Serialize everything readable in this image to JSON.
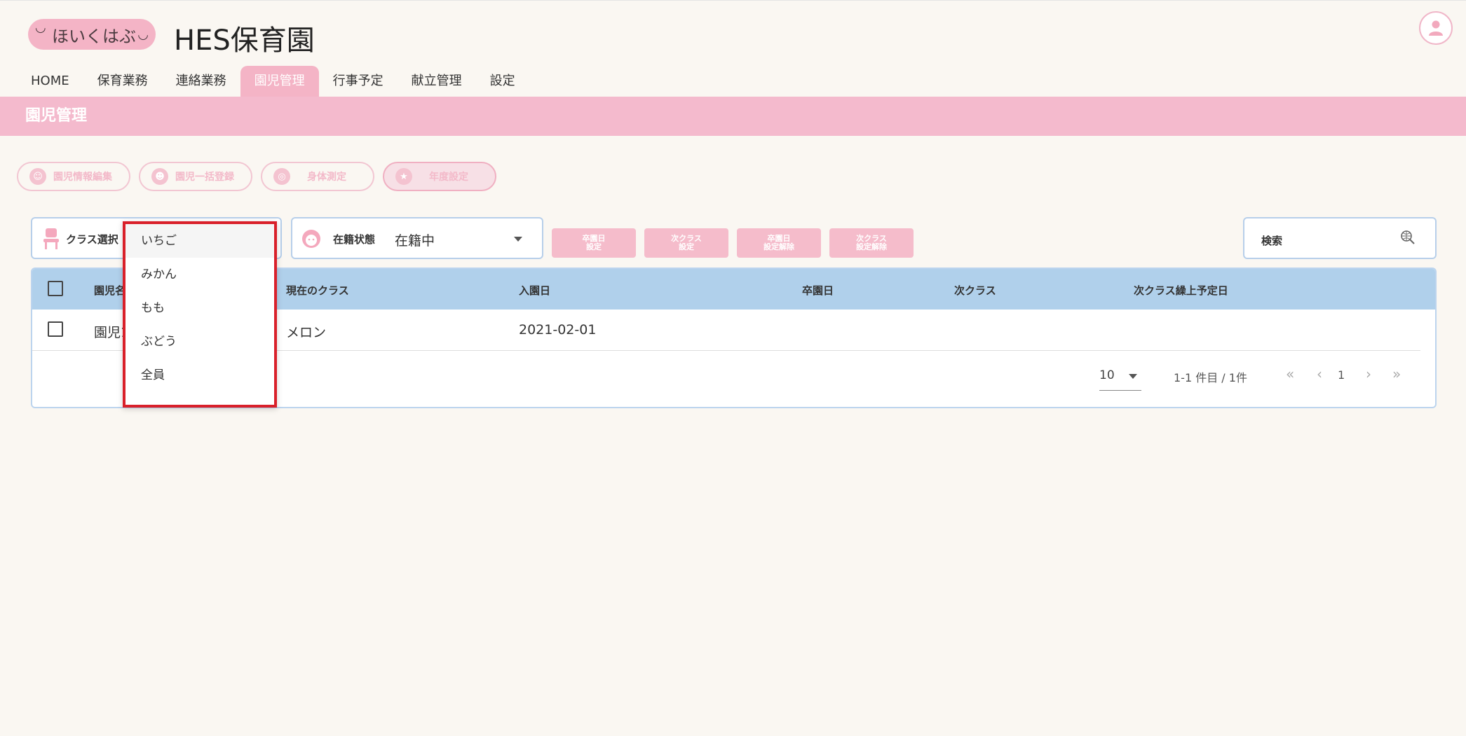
{
  "header": {
    "logo_text": "ほいくはぶ",
    "site_title": "HES保育園"
  },
  "nav": {
    "items": [
      {
        "label": "HOME"
      },
      {
        "label": "保育業務"
      },
      {
        "label": "連絡業務"
      },
      {
        "label": "園児管理",
        "active": true
      },
      {
        "label": "行事予定"
      },
      {
        "label": "献立管理"
      },
      {
        "label": "設定"
      }
    ]
  },
  "section": {
    "title": "園児管理"
  },
  "actions": {
    "child_info_edit": "園児情報編集",
    "bulk_register": "園児一括登録",
    "body_measure": "身体測定",
    "year_setting": "年度設定"
  },
  "filters": {
    "class_label": "クラス選択",
    "status_label": "在籍状態",
    "status_value": "在籍中"
  },
  "buttons": {
    "grad_date_set": "卒園日\n設定",
    "next_class_set": "次クラス\n設定",
    "grad_date_clear": "卒園日\n設定解除",
    "next_class_clear": "次クラス\n設定解除"
  },
  "search": {
    "label": "検索"
  },
  "table": {
    "headers": [
      "園児名",
      "現在のクラス",
      "入園日",
      "卒園日",
      "次クラス",
      "次クラス繰上予定日"
    ],
    "rows": [
      {
        "name": "園児1",
        "class": "メロン",
        "enroll_date": "2021-02-01",
        "grad_date": "",
        "next_class": "",
        "next_date": ""
      }
    ]
  },
  "pagination": {
    "per_page": "10",
    "range": "1-1 件目 / 1件",
    "current_page": "1"
  },
  "dropdown": {
    "options": [
      {
        "label": "いちご",
        "active": true
      },
      {
        "label": "みかん"
      },
      {
        "label": "もも"
      },
      {
        "label": "ぶどう"
      },
      {
        "label": "全員"
      }
    ]
  }
}
